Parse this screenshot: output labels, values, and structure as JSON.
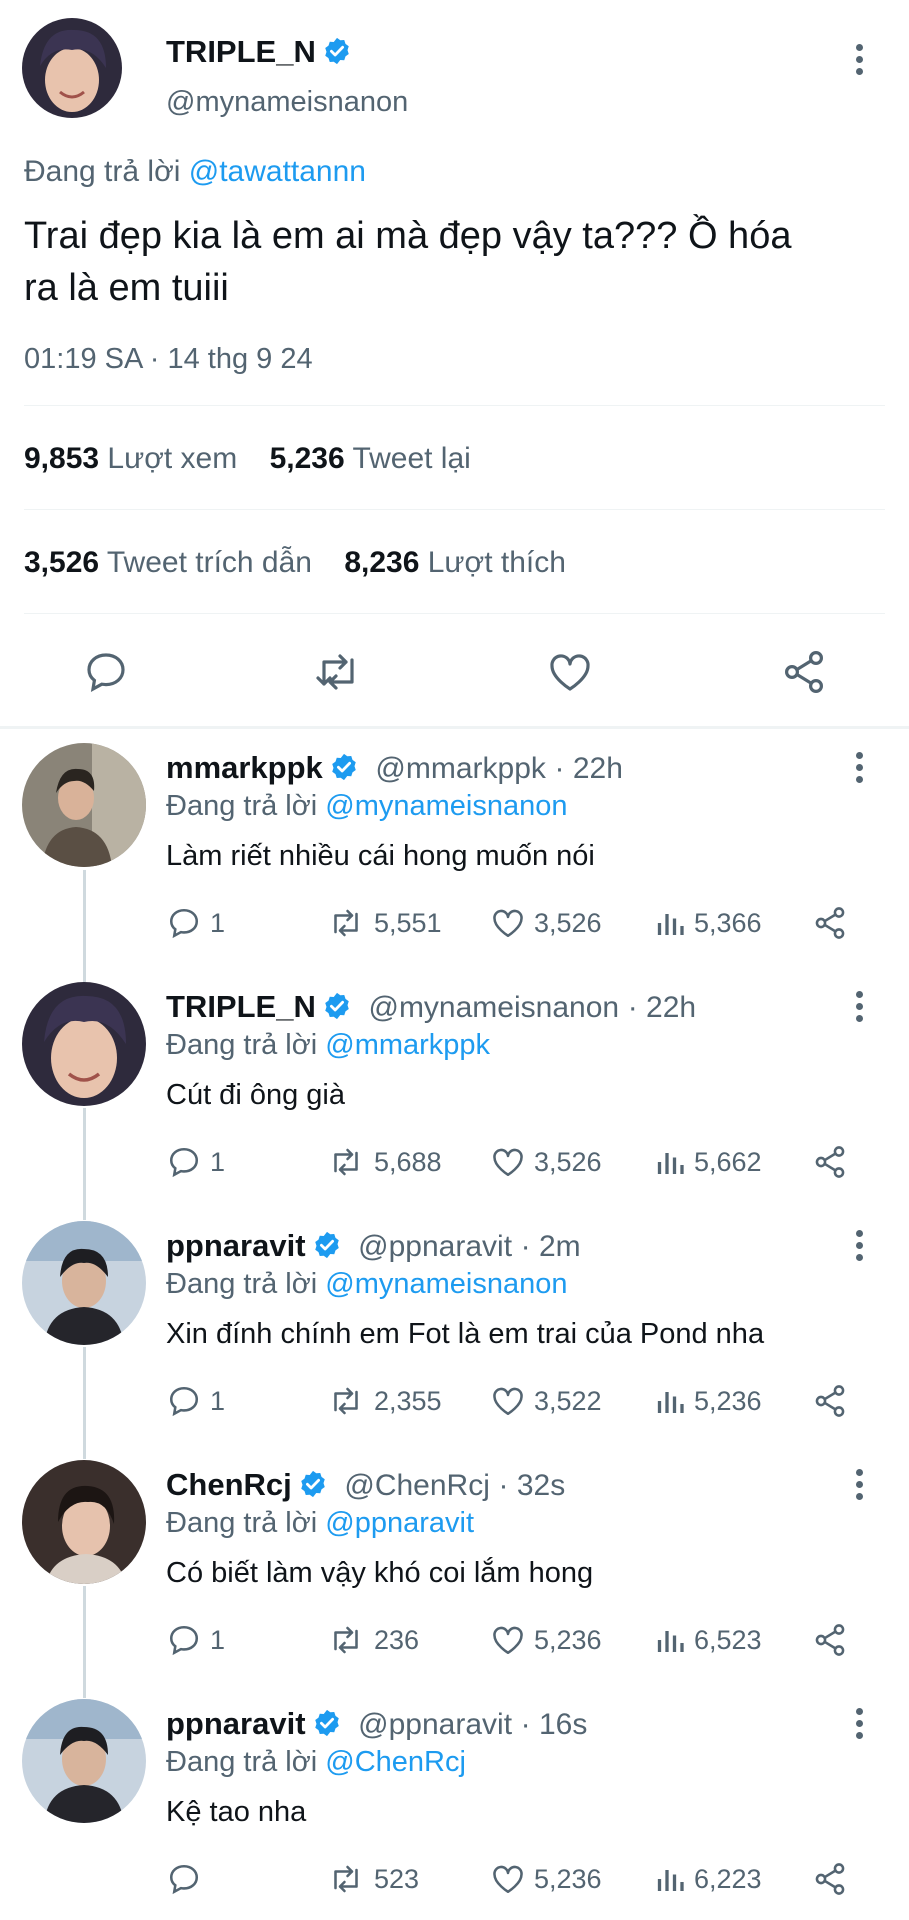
{
  "main_tweet": {
    "display_name": "TRIPLE_N",
    "handle": "@mynameisnanon",
    "replying_prefix": "Đang trả lời",
    "replying_to": "@tawattannn",
    "text_line1": "Trai đẹp kia là em ai mà đẹp vậy ta??? Ồ hóa",
    "text_line2": "ra là em tuiii",
    "timestamp": "01:19 SA · 14 thg 9 24",
    "stats": {
      "views_count": "9,853",
      "views_label": "Lượt xem",
      "retweets_count": "5,236",
      "retweets_label": "Tweet lại",
      "quotes_count": "3,526",
      "quotes_label": "Tweet trích dẫn",
      "likes_count": "8,236",
      "likes_label": "Lượt thích"
    }
  },
  "replies": [
    {
      "display_name": "mmarkppk",
      "handle": "@mmarkppk",
      "time": "· 22h",
      "replying_prefix": "Đang trả lời",
      "replying_to": "@mynameisnanon",
      "text": "Làm riết nhiều cái hong muốn nói",
      "reply_count": "1",
      "retweet_count": "5,551",
      "like_count": "3,526",
      "view_count": "5,366"
    },
    {
      "display_name": "TRIPLE_N",
      "handle": "@mynameisnanon",
      "time": "· 22h",
      "replying_prefix": "Đang trả lời",
      "replying_to": "@mmarkppk",
      "text": "Cút đi ông già",
      "reply_count": "1",
      "retweet_count": "5,688",
      "like_count": "3,526",
      "view_count": "5,662"
    },
    {
      "display_name": "ppnaravit",
      "handle": "@ppnaravit",
      "time": "· 2m",
      "replying_prefix": "Đang trả lời",
      "replying_to": "@mynameisnanon",
      "text": "Xin đính chính em Fot là em trai của Pond nha",
      "reply_count": "1",
      "retweet_count": "2,355",
      "like_count": "3,522",
      "view_count": "5,236"
    },
    {
      "display_name": "ChenRcj",
      "handle": "@ChenRcj",
      "time": "· 32s",
      "replying_prefix": "Đang trả lời",
      "replying_to": "@ppnaravit",
      "text": "Có biết làm vậy khó coi lắm hong",
      "reply_count": "1",
      "retweet_count": "236",
      "like_count": "5,236",
      "view_count": "6,523"
    },
    {
      "display_name": "ppnaravit",
      "handle": "@ppnaravit",
      "time": "· 16s",
      "replying_prefix": "Đang trả lời",
      "replying_to": "@ChenRcj",
      "text": "Kệ tao nha",
      "reply_count": "",
      "retweet_count": "523",
      "like_count": "5,236",
      "view_count": "6,223"
    }
  ],
  "colors": {
    "link": "#1d9bf0",
    "muted": "#536471",
    "text": "#0f1419",
    "verified": "#1d9bf0"
  }
}
